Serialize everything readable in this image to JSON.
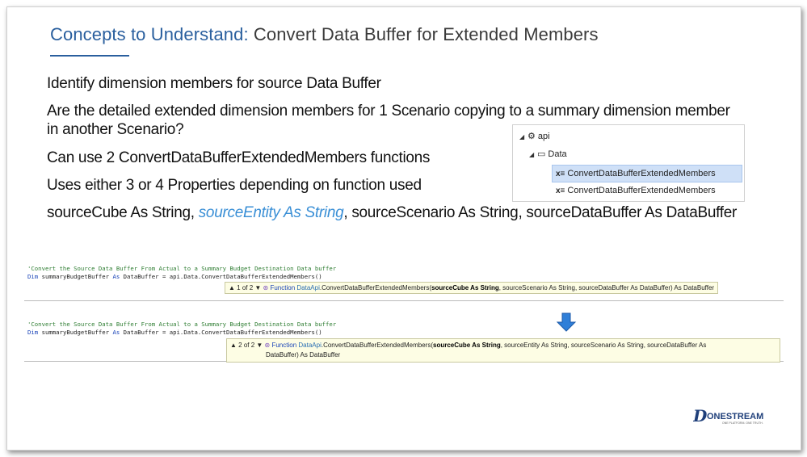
{
  "title": {
    "part1": "Concepts  to  Understand:",
    "part2": "Convert  Data  Buffer  for  Extended  Members"
  },
  "bullets": {
    "b1": "Identify dimension members for source Data Buffer",
    "b2": "Are the detailed extended dimension members for 1 Scenario copying to a summary dimension member in another Scenario?",
    "b3": "Can use 2 ConvertDataBufferExtendedMembers functions",
    "b4": "Uses either 3 or 4 Properties depending on function used",
    "b5_a": "sourceCube As String, ",
    "b5_hl": "sourceEntity",
    "b5_it": " As String",
    "b5_b": ", sourceScenario As String, sourceDataBuffer As DataBuffer"
  },
  "tree": {
    "root": "api",
    "child": "Data",
    "item1": "ConvertDataBufferExtendedMembers",
    "item2": "ConvertDataBufferExtendedMembers"
  },
  "code1": {
    "comment": "'Convert the Source Data Buffer From Actual to a Summary Budget Destination Data buffer",
    "dim": "Dim",
    "var": " summaryBudgetBuffer ",
    "as": "As",
    "rest": " DataBuffer = api.Data.ConvertDataBufferExtendedMembers()",
    "sig_counter": "▲ 1 of 2 ▼",
    "sig_fn": "Function",
    "sig_class": "DataApi",
    "sig_name": ".ConvertDataBufferExtendedMembers(",
    "sig_p1": "sourceCube As String",
    "sig_rest": ", sourceScenario As String, sourceDataBuffer As DataBuffer) As DataBuffer"
  },
  "code2": {
    "comment": "'Convert the Source Data Buffer From Actual to a Summary Budget Destination Data buffer",
    "dim": "Dim",
    "var": " summaryBudgetBuffer ",
    "as": "As",
    "rest": " DataBuffer = api.Data.ConvertDataBufferExtendedMembers()",
    "sig_counter": "▲ 2 of 2 ▼",
    "sig_fn": "Function",
    "sig_class": "DataApi",
    "sig_name": ".ConvertDataBufferExtendedMembers(",
    "sig_p1": "sourceCube As String",
    "sig_rest": ", sourceEntity As String, sourceScenario As String, sourceDataBuffer As",
    "sig_line2": "DataBuffer) As DataBuffer"
  },
  "logo": {
    "text": "ONESTREAM",
    "tagline": "ONE PLATFORM. ONE TRUTH."
  },
  "colors": {
    "title": "#2a5f9e",
    "highlight": "#3a8fd6",
    "arrow": "#2f7fd8"
  }
}
